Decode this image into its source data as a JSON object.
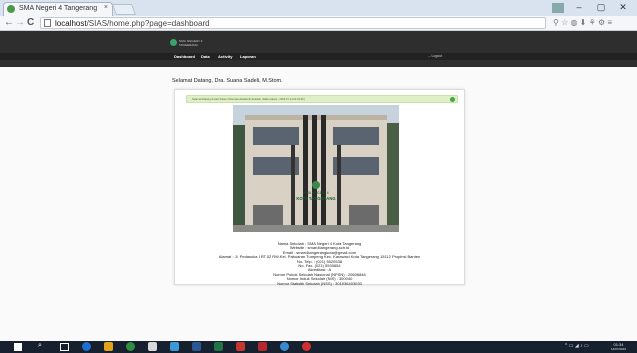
{
  "browser": {
    "tab_title": "SMA Negeri 4 Tangerang",
    "tab_close": "×",
    "url_host": "localhost",
    "url_path": "/SIAS/home.php?page=dashboard",
    "back": "←",
    "forward": "→",
    "reload": "C",
    "window_minimize": "–",
    "window_maximize": "▢",
    "window_close": "✕",
    "toolbar_icons": "⚲ ☆ ◍ ⬇ ⚘ ⚙ ≡"
  },
  "site": {
    "logo_line1": "SMA NEGERI 4",
    "logo_line2": "TANGERANG",
    "nav": [
      "Dashboard",
      "Data",
      "Activity",
      "Laporan"
    ],
    "logout": "→ Logout"
  },
  "main": {
    "welcome": "Selamat Datang, Dra. Suana Sadeli, M.Stom.",
    "alert_text": "Selamat Datang di web Sistem Informasi Akademik Sekolah, Waktu Akses : 2016-07-14 01:34:49 |",
    "info_lines": [
      "Nama Sekolah : SMA Negeri 4 Kota Tangerang",
      "Website : sman4tangerang.sch.id",
      "Email : sman4tangerangkota@gmail.com",
      "Alamat : Jl. Pedasuka I RT.02 RW.Kel. Pabuaran Tumpeng Kec. Karawaci Kota Tangerang 15112 Propinsi Banten",
      "No. Telp. : (021) 5520538",
      "No. Fax. (021) 5530654",
      "Akreditasi : A",
      "Nomor Pokok Sekolah Nasional (NPSN) : 20606846",
      "Nomor Induk Sekolah (NIS) : 300040",
      "Nomor Statistik Sekolah (NSS) : 301036403030"
    ]
  },
  "building_sign": {
    "line1": "SMA NEGERI 4",
    "line2": "KOTA TANGERANG"
  },
  "taskbar": {
    "tray": "^ ▭ ◢ ♪ ▭",
    "time": "01:34",
    "date": "14/07/2016"
  },
  "colors": {
    "header_bg": "#2e2e2e",
    "nav_bg": "#222222",
    "alert_bg": "#dff0c8",
    "alert_check": "#46a846",
    "taskbar_bg": "#16202e"
  }
}
